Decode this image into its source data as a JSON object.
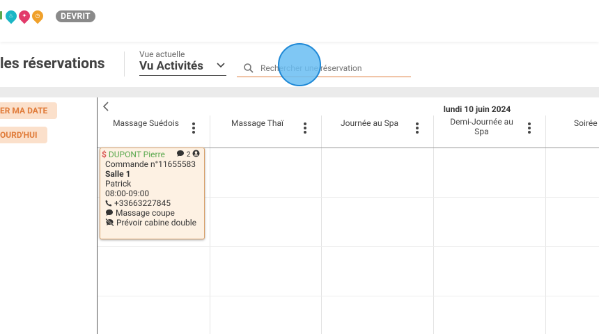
{
  "topbar": {
    "logo_glyphs": [
      "(eat)",
      "run",
      "clock"
    ],
    "badge": "DEVRIT"
  },
  "page": {
    "title": "les réservations"
  },
  "view": {
    "label": "Vue actuelle",
    "value": "Vu Activités"
  },
  "search": {
    "placeholder": "Rechercher une réservation"
  },
  "buttons": {
    "choose_date": "ER MA DATE",
    "today": "OURD'HUI"
  },
  "calendar": {
    "date": "lundi 10 juin 2024",
    "columns": [
      {
        "name": "Massage Suédois"
      },
      {
        "name": "Massage Thaï"
      },
      {
        "name": "Journée au Spa"
      },
      {
        "name": "Demi-Journée au Spa"
      },
      {
        "name": "Soirée"
      }
    ]
  },
  "event": {
    "currency_symbol": "$",
    "client": "DUPONT Pierre",
    "comment_count": "2",
    "order": "Commande n°11655583",
    "room": "Salle 1",
    "staff": "Patrick",
    "time": "08:00-09:00",
    "phone": "+33663227845",
    "note1": "Massage coupe",
    "note2": "Prévoir cabine double"
  },
  "colors": {
    "accent_orange": "#e07b39",
    "client_green": "#5aa84e",
    "event_bg": "#fdf1e3",
    "cursor_blue": "#69bdf2",
    "pin_teal": "#1bb6c5",
    "pin_pink": "#e23a6a",
    "pin_orange": "#f0a12b"
  }
}
